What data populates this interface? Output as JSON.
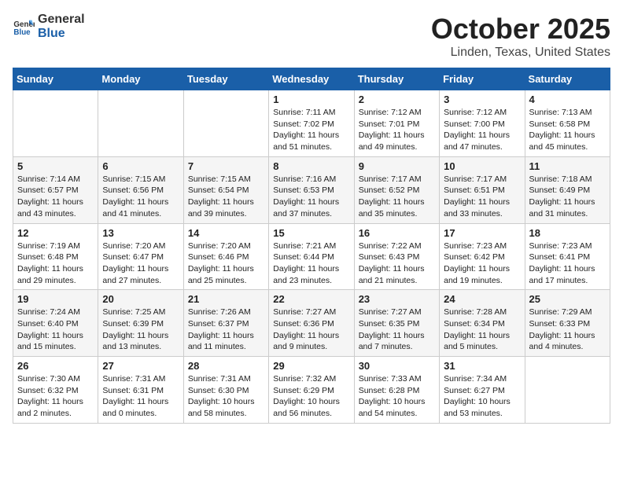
{
  "header": {
    "logo_general": "General",
    "logo_blue": "Blue",
    "month": "October 2025",
    "location": "Linden, Texas, United States"
  },
  "weekdays": [
    "Sunday",
    "Monday",
    "Tuesday",
    "Wednesday",
    "Thursday",
    "Friday",
    "Saturday"
  ],
  "weeks": [
    [
      {
        "day": "",
        "info": ""
      },
      {
        "day": "",
        "info": ""
      },
      {
        "day": "",
        "info": ""
      },
      {
        "day": "1",
        "info": "Sunrise: 7:11 AM\nSunset: 7:02 PM\nDaylight: 11 hours\nand 51 minutes."
      },
      {
        "day": "2",
        "info": "Sunrise: 7:12 AM\nSunset: 7:01 PM\nDaylight: 11 hours\nand 49 minutes."
      },
      {
        "day": "3",
        "info": "Sunrise: 7:12 AM\nSunset: 7:00 PM\nDaylight: 11 hours\nand 47 minutes."
      },
      {
        "day": "4",
        "info": "Sunrise: 7:13 AM\nSunset: 6:58 PM\nDaylight: 11 hours\nand 45 minutes."
      }
    ],
    [
      {
        "day": "5",
        "info": "Sunrise: 7:14 AM\nSunset: 6:57 PM\nDaylight: 11 hours\nand 43 minutes."
      },
      {
        "day": "6",
        "info": "Sunrise: 7:15 AM\nSunset: 6:56 PM\nDaylight: 11 hours\nand 41 minutes."
      },
      {
        "day": "7",
        "info": "Sunrise: 7:15 AM\nSunset: 6:54 PM\nDaylight: 11 hours\nand 39 minutes."
      },
      {
        "day": "8",
        "info": "Sunrise: 7:16 AM\nSunset: 6:53 PM\nDaylight: 11 hours\nand 37 minutes."
      },
      {
        "day": "9",
        "info": "Sunrise: 7:17 AM\nSunset: 6:52 PM\nDaylight: 11 hours\nand 35 minutes."
      },
      {
        "day": "10",
        "info": "Sunrise: 7:17 AM\nSunset: 6:51 PM\nDaylight: 11 hours\nand 33 minutes."
      },
      {
        "day": "11",
        "info": "Sunrise: 7:18 AM\nSunset: 6:49 PM\nDaylight: 11 hours\nand 31 minutes."
      }
    ],
    [
      {
        "day": "12",
        "info": "Sunrise: 7:19 AM\nSunset: 6:48 PM\nDaylight: 11 hours\nand 29 minutes."
      },
      {
        "day": "13",
        "info": "Sunrise: 7:20 AM\nSunset: 6:47 PM\nDaylight: 11 hours\nand 27 minutes."
      },
      {
        "day": "14",
        "info": "Sunrise: 7:20 AM\nSunset: 6:46 PM\nDaylight: 11 hours\nand 25 minutes."
      },
      {
        "day": "15",
        "info": "Sunrise: 7:21 AM\nSunset: 6:44 PM\nDaylight: 11 hours\nand 23 minutes."
      },
      {
        "day": "16",
        "info": "Sunrise: 7:22 AM\nSunset: 6:43 PM\nDaylight: 11 hours\nand 21 minutes."
      },
      {
        "day": "17",
        "info": "Sunrise: 7:23 AM\nSunset: 6:42 PM\nDaylight: 11 hours\nand 19 minutes."
      },
      {
        "day": "18",
        "info": "Sunrise: 7:23 AM\nSunset: 6:41 PM\nDaylight: 11 hours\nand 17 minutes."
      }
    ],
    [
      {
        "day": "19",
        "info": "Sunrise: 7:24 AM\nSunset: 6:40 PM\nDaylight: 11 hours\nand 15 minutes."
      },
      {
        "day": "20",
        "info": "Sunrise: 7:25 AM\nSunset: 6:39 PM\nDaylight: 11 hours\nand 13 minutes."
      },
      {
        "day": "21",
        "info": "Sunrise: 7:26 AM\nSunset: 6:37 PM\nDaylight: 11 hours\nand 11 minutes."
      },
      {
        "day": "22",
        "info": "Sunrise: 7:27 AM\nSunset: 6:36 PM\nDaylight: 11 hours\nand 9 minutes."
      },
      {
        "day": "23",
        "info": "Sunrise: 7:27 AM\nSunset: 6:35 PM\nDaylight: 11 hours\nand 7 minutes."
      },
      {
        "day": "24",
        "info": "Sunrise: 7:28 AM\nSunset: 6:34 PM\nDaylight: 11 hours\nand 5 minutes."
      },
      {
        "day": "25",
        "info": "Sunrise: 7:29 AM\nSunset: 6:33 PM\nDaylight: 11 hours\nand 4 minutes."
      }
    ],
    [
      {
        "day": "26",
        "info": "Sunrise: 7:30 AM\nSunset: 6:32 PM\nDaylight: 11 hours\nand 2 minutes."
      },
      {
        "day": "27",
        "info": "Sunrise: 7:31 AM\nSunset: 6:31 PM\nDaylight: 11 hours\nand 0 minutes."
      },
      {
        "day": "28",
        "info": "Sunrise: 7:31 AM\nSunset: 6:30 PM\nDaylight: 10 hours\nand 58 minutes."
      },
      {
        "day": "29",
        "info": "Sunrise: 7:32 AM\nSunset: 6:29 PM\nDaylight: 10 hours\nand 56 minutes."
      },
      {
        "day": "30",
        "info": "Sunrise: 7:33 AM\nSunset: 6:28 PM\nDaylight: 10 hours\nand 54 minutes."
      },
      {
        "day": "31",
        "info": "Sunrise: 7:34 AM\nSunset: 6:27 PM\nDaylight: 10 hours\nand 53 minutes."
      },
      {
        "day": "",
        "info": ""
      }
    ]
  ]
}
